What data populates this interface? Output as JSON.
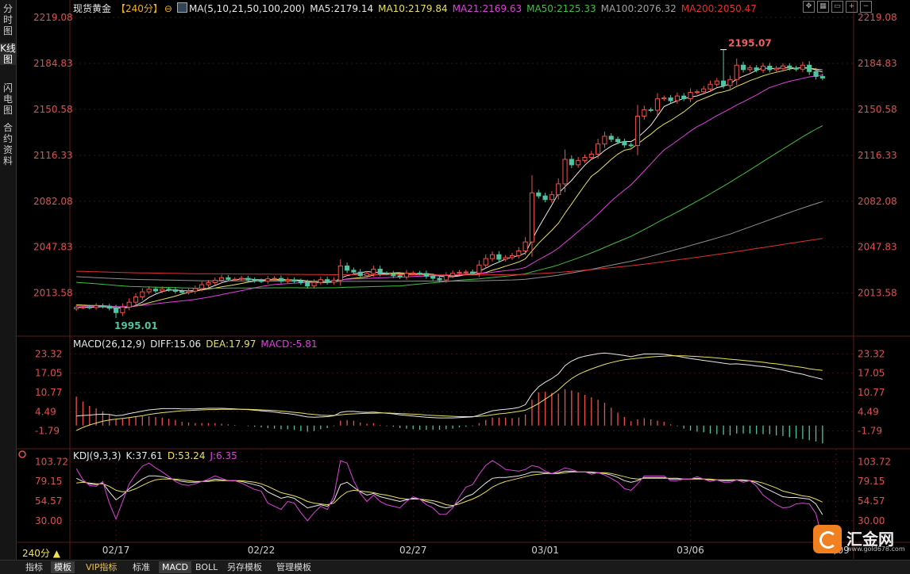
{
  "sidebar": {
    "tabs": [
      {
        "label": "分时图",
        "active": false
      },
      {
        "label": "K线图",
        "active": true
      },
      {
        "label": "闪电图",
        "active": false
      },
      {
        "label": "合约资料",
        "active": false
      }
    ]
  },
  "header": {
    "symbol": "现货黄金",
    "period_tag": "【240分】",
    "ma_params": "MA(5,10,21,50,100,200)",
    "ma5": "MA5:2179.14",
    "ma10": "MA10:2179.84",
    "ma21": "MA21:2169.63",
    "ma50": "MA50:2125.33",
    "ma100": "MA100:2076.32",
    "ma200": "MA200:2050.47"
  },
  "colors": {
    "up": "#f0504a",
    "down": "#4ec4a0",
    "ma5": "#e8e8e8",
    "ma10": "#e8e060",
    "ma21": "#e040e0",
    "ma50": "#40c040",
    "ma100": "#909090",
    "ma200": "#e03030",
    "axis_label": "#e05050",
    "grid": "#4a1a1a",
    "dif": "#e8e8e8",
    "dea": "#e8e060",
    "macd_neg": "#4ec4a0"
  },
  "annotations": {
    "high": "2195.07",
    "low": "1995.01"
  },
  "macd": {
    "params": "MACD(26,12,9)",
    "diff": "DIFF:15.06",
    "dea": "DEA:17.97",
    "macd": "MACD:-5.81"
  },
  "kdj": {
    "params": "KDJ(9,3,3)",
    "k": "K:37.61",
    "d": "D:53.24",
    "j": "J:6.35"
  },
  "chart_data": {
    "type": "candlestick",
    "price_axis_ticks": [
      2219.08,
      2184.83,
      2150.58,
      2116.33,
      2082.08,
      2047.83,
      2013.58
    ],
    "price_range": [
      1985,
      2225
    ],
    "macd_axis_ticks": [
      23.32,
      17.05,
      10.77,
      4.49,
      -1.79
    ],
    "macd_range": [
      -6,
      26
    ],
    "kdj_axis_ticks": [
      103.72,
      79.15,
      54.57,
      30.0
    ],
    "kdj_range": [
      5,
      110
    ],
    "date_labels": [
      "02/17",
      "02/22",
      "02/27",
      "03/01",
      "03/06",
      "03/09"
    ],
    "date_label_index": [
      6,
      28,
      51,
      71,
      93,
      115
    ],
    "candles": [
      2003.0,
      2003.2,
      2002.8,
      2004.1,
      2003.6,
      2002.3,
      1999.0,
      2003.1,
      2006.8,
      2010.7,
      2014.5,
      2016.5,
      2015.2,
      2016.5,
      2016.1,
      2014.9,
      2014.1,
      2015.0,
      2017.0,
      2019.8,
      2021.3,
      2023.1,
      2025.0,
      2023.8,
      2023.9,
      2024.6,
      2023.5,
      2022.8,
      2022.4,
      2024.2,
      2024.5,
      2022.5,
      2023.4,
      2022.5,
      2021.3,
      2018.9,
      2021.5,
      2023.6,
      2021.7,
      2023.2,
      2033.8,
      2030.6,
      2029.2,
      2026.6,
      2028.1,
      2031.4,
      2028.2,
      2028.1,
      2026.5,
      2025.6,
      2028.4,
      2028.5,
      2028.2,
      2026.1,
      2024.6,
      2023.4,
      2026.6,
      2028.3,
      2029.0,
      2029.3,
      2028.4,
      2034.5,
      2039.3,
      2042.2,
      2038.8,
      2040.0,
      2041.5,
      2045.0,
      2051.7,
      2088.3,
      2086.0,
      2083.3,
      2086.9,
      2095.0,
      2113.3,
      2109.2,
      2112.5,
      2114.7,
      2117.2,
      2124.7,
      2130.5,
      2128.2,
      2126.4,
      2124.0,
      2123.6,
      2145.5,
      2150.3,
      2149.9,
      2158.4,
      2159.1,
      2157.0,
      2160.5,
      2158.5,
      2163.2,
      2163.7,
      2165.8,
      2169.3,
      2171.7,
      2168.3,
      2172.8,
      2183.5,
      2180.2,
      2181.5,
      2179.9,
      2182.8,
      2180.1,
      2181.1,
      2182.9,
      2181.3,
      2180.5,
      2183.5,
      2178.7,
      2175.1,
      2173.9
    ],
    "note_candles": "close prices, 114 bars of 240-minute candles",
    "series": [
      {
        "name": "DIFF",
        "values": [
          3.1,
          3.3,
          3.4,
          3.6,
          3.7,
          3.6,
          3.2,
          3.4,
          3.9,
          4.3,
          4.7,
          5.1,
          5.3,
          5.5,
          5.5,
          5.5,
          5.4,
          5.4,
          5.4,
          5.5,
          5.6,
          5.6,
          5.6,
          5.5,
          5.4,
          5.3,
          5.2,
          5.0,
          4.8,
          4.6,
          4.4,
          4.1,
          3.9,
          3.6,
          3.2,
          2.8,
          2.7,
          2.8,
          2.9,
          3.2,
          4.3,
          4.6,
          4.6,
          4.4,
          4.3,
          4.4,
          4.2,
          4.0,
          3.8,
          3.5,
          3.3,
          3.1,
          2.9,
          2.7,
          2.6,
          2.5,
          2.5,
          2.5,
          2.6,
          2.7,
          2.8,
          3.4,
          4.1,
          4.8,
          5.1,
          5.3,
          5.5,
          5.9,
          6.8,
          10.2,
          12.6,
          14.1,
          15.3,
          16.8,
          19.5,
          21.0,
          22.0,
          22.6,
          23.0,
          23.4,
          23.6,
          23.4,
          23.1,
          22.8,
          22.4,
          22.9,
          23.3,
          23.3,
          23.3,
          23.2,
          22.9,
          22.6,
          22.2,
          21.8,
          21.5,
          21.2,
          20.9,
          20.6,
          20.3,
          20.0,
          20.1,
          19.9,
          19.7,
          19.4,
          19.2,
          18.9,
          18.5,
          18.1,
          17.6,
          17.1,
          16.7,
          16.1,
          15.6,
          15.06
        ]
      },
      {
        "name": "DEA",
        "values": [
          -1.6,
          -0.6,
          0.2,
          0.8,
          1.4,
          1.8,
          2.1,
          2.3,
          2.6,
          2.9,
          3.2,
          3.6,
          3.9,
          4.2,
          4.4,
          4.6,
          4.8,
          4.9,
          5.0,
          5.1,
          5.2,
          5.2,
          5.3,
          5.3,
          5.3,
          5.3,
          5.3,
          5.2,
          5.1,
          5.0,
          4.9,
          4.7,
          4.5,
          4.3,
          4.1,
          3.8,
          3.6,
          3.4,
          3.3,
          3.3,
          3.5,
          3.7,
          3.8,
          3.9,
          4.0,
          4.0,
          4.1,
          4.1,
          4.0,
          3.9,
          3.8,
          3.7,
          3.6,
          3.4,
          3.3,
          3.2,
          3.1,
          3.0,
          2.9,
          2.9,
          2.9,
          3.0,
          3.2,
          3.5,
          3.8,
          4.0,
          4.3,
          4.6,
          5.0,
          6.0,
          7.2,
          8.6,
          10.0,
          11.6,
          13.6,
          15.3,
          16.6,
          17.6,
          18.4,
          19.2,
          19.9,
          20.5,
          21.0,
          21.4,
          21.7,
          21.9,
          22.1,
          22.3,
          22.5,
          22.6,
          22.7,
          22.7,
          22.7,
          22.6,
          22.5,
          22.3,
          22.2,
          22.0,
          21.8,
          21.6,
          21.4,
          21.2,
          21.0,
          20.8,
          20.6,
          20.3,
          20.1,
          19.8,
          19.5,
          19.2,
          18.9,
          18.5,
          18.2,
          17.97
        ]
      },
      {
        "name": "MACD",
        "values": [
          9.4,
          7.8,
          6.4,
          5.6,
          4.6,
          3.6,
          2.2,
          2.2,
          2.6,
          2.8,
          3.0,
          3.0,
          2.8,
          2.6,
          2.2,
          1.8,
          1.2,
          1.0,
          0.8,
          0.8,
          0.8,
          0.8,
          0.6,
          0.4,
          0.2,
          0.0,
          -0.2,
          -0.4,
          -0.6,
          -0.8,
          -1.0,
          -1.2,
          -1.2,
          -1.4,
          -1.8,
          -2.0,
          -1.8,
          -1.2,
          -0.8,
          -0.2,
          1.6,
          1.8,
          1.6,
          1.0,
          0.6,
          0.8,
          0.2,
          -0.2,
          -0.4,
          -0.8,
          -1.0,
          -1.2,
          -1.4,
          -1.4,
          -1.4,
          -1.4,
          -1.2,
          -1.0,
          -0.6,
          -0.4,
          -0.2,
          0.8,
          1.8,
          2.6,
          2.6,
          2.6,
          2.4,
          2.6,
          3.6,
          8.4,
          10.8,
          11.0,
          10.6,
          10.4,
          11.8,
          11.4,
          10.8,
          10.0,
          9.2,
          8.4,
          7.4,
          5.8,
          4.2,
          2.8,
          1.4,
          2.0,
          2.4,
          2.0,
          1.6,
          1.2,
          0.4,
          -0.2,
          -1.0,
          -1.6,
          -2.0,
          -2.2,
          -2.6,
          -2.8,
          -3.0,
          -3.2,
          -2.6,
          -2.6,
          -2.6,
          -2.8,
          -2.8,
          -2.8,
          -3.2,
          -3.4,
          -3.8,
          -4.2,
          -4.4,
          -4.8,
          -5.2,
          -5.81
        ]
      },
      {
        "name": "K",
        "values": [
          83,
          79,
          76,
          75,
          77,
          66,
          56,
          62,
          70,
          76,
          82,
          86,
          86,
          85,
          83,
          81,
          79,
          78,
          78,
          79,
          80,
          82,
          81,
          80,
          80,
          79,
          77,
          75,
          73,
          66,
          62,
          58,
          60,
          58,
          52,
          46,
          48,
          50,
          48,
          55,
          75,
          78,
          72,
          66,
          62,
          64,
          60,
          58,
          56,
          54,
          56,
          58,
          57,
          54,
          52,
          48,
          46,
          48,
          54,
          60,
          63,
          70,
          77,
          83,
          84,
          84,
          85,
          86,
          88,
          91,
          91,
          90,
          89,
          90,
          92,
          92,
          91,
          91,
          90,
          90,
          89,
          87,
          84,
          80,
          78,
          80,
          84,
          84,
          84,
          84,
          82,
          82,
          82,
          82,
          83,
          82,
          81,
          81,
          80,
          80,
          81,
          80,
          80,
          77,
          72,
          68,
          64,
          60,
          59,
          59,
          58,
          57,
          51,
          37.61
        ]
      },
      {
        "name": "D",
        "values": [
          77,
          78,
          77,
          76,
          76,
          73,
          68,
          66,
          67,
          70,
          74,
          78,
          81,
          82,
          82,
          82,
          81,
          80,
          79,
          79,
          79,
          80,
          80,
          80,
          80,
          80,
          79,
          78,
          76,
          73,
          69,
          65,
          63,
          61,
          58,
          54,
          52,
          51,
          50,
          52,
          60,
          66,
          68,
          67,
          66,
          65,
          63,
          62,
          60,
          58,
          57,
          57,
          57,
          56,
          55,
          53,
          50,
          49,
          51,
          54,
          57,
          61,
          66,
          72,
          76,
          79,
          81,
          83,
          85,
          87,
          88,
          89,
          89,
          89,
          90,
          91,
          91,
          91,
          91,
          90,
          90,
          89,
          87,
          85,
          83,
          82,
          83,
          83,
          83,
          83,
          83,
          83,
          82,
          82,
          82,
          82,
          82,
          81,
          81,
          81,
          81,
          81,
          80,
          79,
          77,
          74,
          71,
          67,
          65,
          63,
          61,
          60,
          57,
          53.24
        ]
      },
      {
        "name": "J",
        "values": [
          95,
          81,
          74,
          73,
          79,
          52,
          32,
          54,
          76,
          88,
          98,
          102,
          96,
          91,
          85,
          79,
          75,
          74,
          76,
          79,
          82,
          86,
          83,
          80,
          80,
          77,
          73,
          69,
          67,
          52,
          48,
          44,
          54,
          52,
          40,
          30,
          40,
          48,
          44,
          61,
          105,
          102,
          80,
          64,
          54,
          62,
          54,
          50,
          48,
          46,
          54,
          60,
          57,
          50,
          46,
          38,
          38,
          46,
          60,
          72,
          75,
          88,
          99,
          105,
          100,
          94,
          93,
          92,
          94,
          99,
          97,
          92,
          89,
          92,
          96,
          94,
          91,
          91,
          88,
          90,
          87,
          83,
          78,
          70,
          68,
          76,
          86,
          86,
          86,
          86,
          80,
          80,
          82,
          82,
          85,
          82,
          79,
          81,
          78,
          78,
          81,
          78,
          80,
          73,
          62,
          56,
          50,
          46,
          47,
          51,
          52,
          51,
          39,
          6.35
        ]
      }
    ]
  },
  "x_axis_period": "240分 ▲",
  "bottom_tabs": [
    "指标",
    "模板",
    "VIP指标",
    "标准",
    "MACD",
    "BOLL",
    "另存模板",
    "管理模板"
  ],
  "logo": {
    "text": "汇金网",
    "url": "www.gold678.com"
  }
}
